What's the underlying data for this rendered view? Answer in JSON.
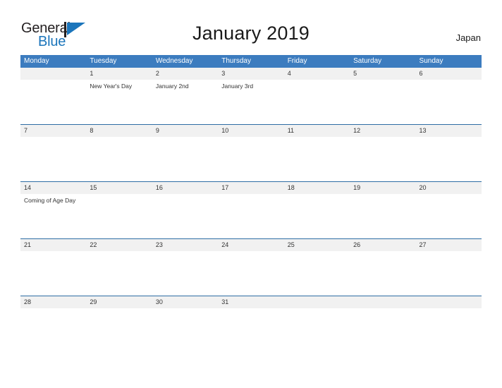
{
  "brand": {
    "name_part1": "General",
    "name_part2": "Blue",
    "flag_color": "#1b75bb",
    "text_color": "#231f20"
  },
  "header": {
    "title": "January 2019",
    "country": "Japan"
  },
  "theme": {
    "header_bar_color": "#3c7cbf",
    "date_band_color": "#f1f1f1",
    "divider_color": "#2e6da4",
    "text_color": "#333333"
  },
  "calendar": {
    "weekdays": [
      "Monday",
      "Tuesday",
      "Wednesday",
      "Thursday",
      "Friday",
      "Saturday",
      "Sunday"
    ],
    "weeks": [
      {
        "days": [
          {
            "date": "",
            "events": []
          },
          {
            "date": "1",
            "events": [
              "New Year's Day"
            ]
          },
          {
            "date": "2",
            "events": [
              "January 2nd"
            ]
          },
          {
            "date": "3",
            "events": [
              "January 3rd"
            ]
          },
          {
            "date": "4",
            "events": []
          },
          {
            "date": "5",
            "events": []
          },
          {
            "date": "6",
            "events": []
          }
        ]
      },
      {
        "days": [
          {
            "date": "7",
            "events": []
          },
          {
            "date": "8",
            "events": []
          },
          {
            "date": "9",
            "events": []
          },
          {
            "date": "10",
            "events": []
          },
          {
            "date": "11",
            "events": []
          },
          {
            "date": "12",
            "events": []
          },
          {
            "date": "13",
            "events": []
          }
        ]
      },
      {
        "days": [
          {
            "date": "14",
            "events": [
              "Coming of Age Day"
            ]
          },
          {
            "date": "15",
            "events": []
          },
          {
            "date": "16",
            "events": []
          },
          {
            "date": "17",
            "events": []
          },
          {
            "date": "18",
            "events": []
          },
          {
            "date": "19",
            "events": []
          },
          {
            "date": "20",
            "events": []
          }
        ]
      },
      {
        "days": [
          {
            "date": "21",
            "events": []
          },
          {
            "date": "22",
            "events": []
          },
          {
            "date": "23",
            "events": []
          },
          {
            "date": "24",
            "events": []
          },
          {
            "date": "25",
            "events": []
          },
          {
            "date": "26",
            "events": []
          },
          {
            "date": "27",
            "events": []
          }
        ]
      },
      {
        "days": [
          {
            "date": "28",
            "events": []
          },
          {
            "date": "29",
            "events": []
          },
          {
            "date": "30",
            "events": []
          },
          {
            "date": "31",
            "events": []
          },
          {
            "date": "",
            "events": []
          },
          {
            "date": "",
            "events": []
          },
          {
            "date": "",
            "events": []
          }
        ]
      }
    ]
  }
}
